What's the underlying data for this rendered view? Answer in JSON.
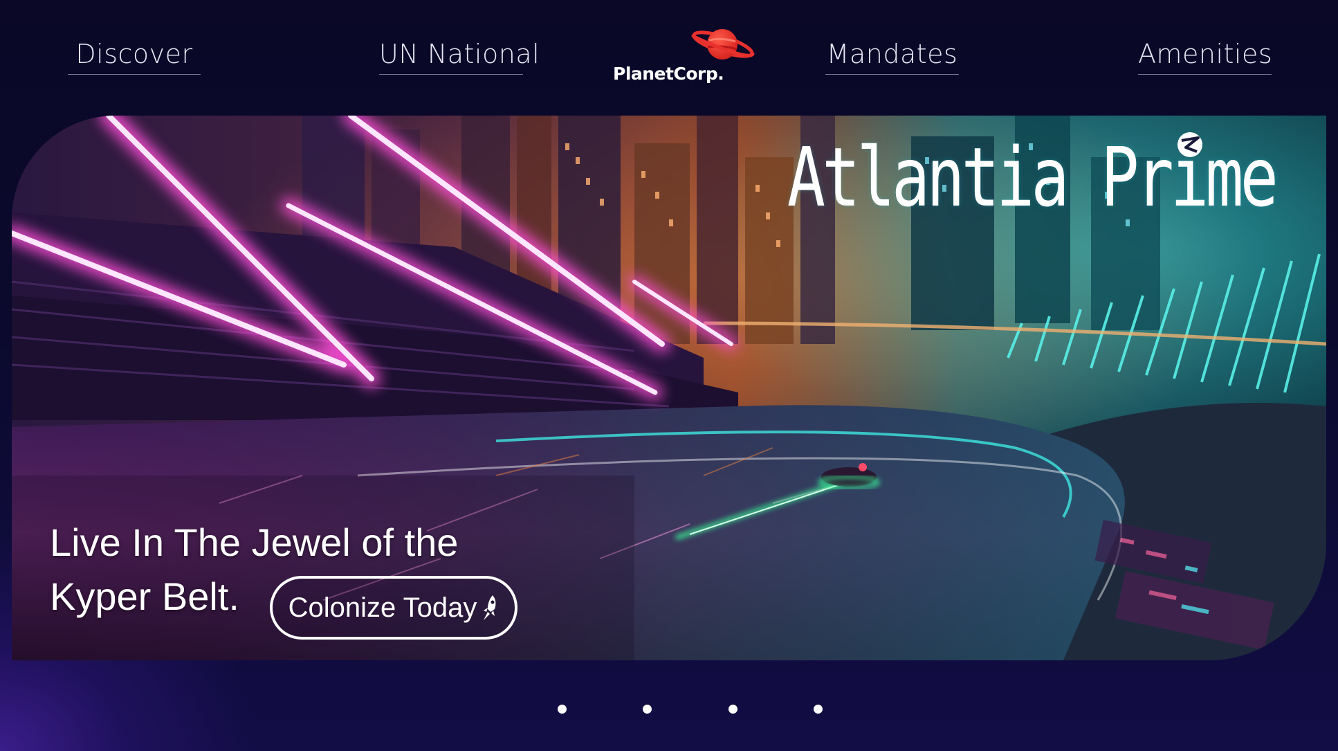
{
  "nav": {
    "items": [
      {
        "label": "Discover"
      },
      {
        "label": "UN National"
      },
      {
        "label": "Mandates"
      },
      {
        "label": "Amenities"
      }
    ]
  },
  "logo": {
    "text": "PlanetCorp.",
    "icon": "ringed-planet-icon",
    "color": "#e8302c"
  },
  "hero": {
    "title": "Atlantia Prime",
    "tagline_line1": "Live In The Jewel of the",
    "tagline_line2": "Kyper Belt.",
    "cta_label": "Colonize Today",
    "cta_icon": "rocket-icon",
    "image": "neon-futuristic-racetrack-city"
  },
  "carousel": {
    "dot_count": 4
  },
  "colors": {
    "background": "#0b0a2e",
    "text": "#ffffff",
    "neon_pink": "#ff4fd8",
    "neon_teal": "#3fe6e0",
    "neon_orange": "#ff8a3d"
  }
}
